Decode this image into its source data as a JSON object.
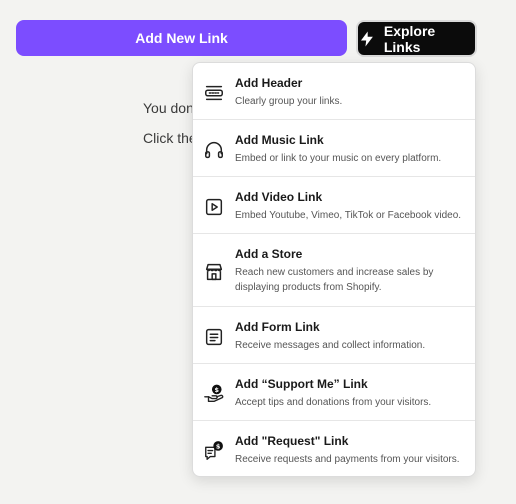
{
  "toolbar": {
    "add_label": "Add New Link",
    "explore_label": "Explore Links",
    "accent": "#7c4dff"
  },
  "background": {
    "line1": "You don",
    "line2": "Click the"
  },
  "menu": {
    "items": [
      {
        "icon": "header-icon",
        "title": "Add Header",
        "desc": "Clearly group your links."
      },
      {
        "icon": "headphones-icon",
        "title": "Add Music Link",
        "desc": "Embed or link to your music on every platform."
      },
      {
        "icon": "video-play-icon",
        "title": "Add Video Link",
        "desc": "Embed Youtube, Vimeo, TikTok or Facebook video."
      },
      {
        "icon": "store-icon",
        "title": "Add a Store",
        "desc": "Reach new customers and increase sales by displaying products from Shopify."
      },
      {
        "icon": "form-icon",
        "title": "Add Form Link",
        "desc": "Receive messages and collect information."
      },
      {
        "icon": "donation-hand-icon",
        "title": "Add “Support Me” Link",
        "desc": "Accept tips and donations from your visitors."
      },
      {
        "icon": "request-chat-icon",
        "title": "Add \"Request\" Link",
        "desc": "Receive requests and payments from your visitors."
      }
    ]
  }
}
